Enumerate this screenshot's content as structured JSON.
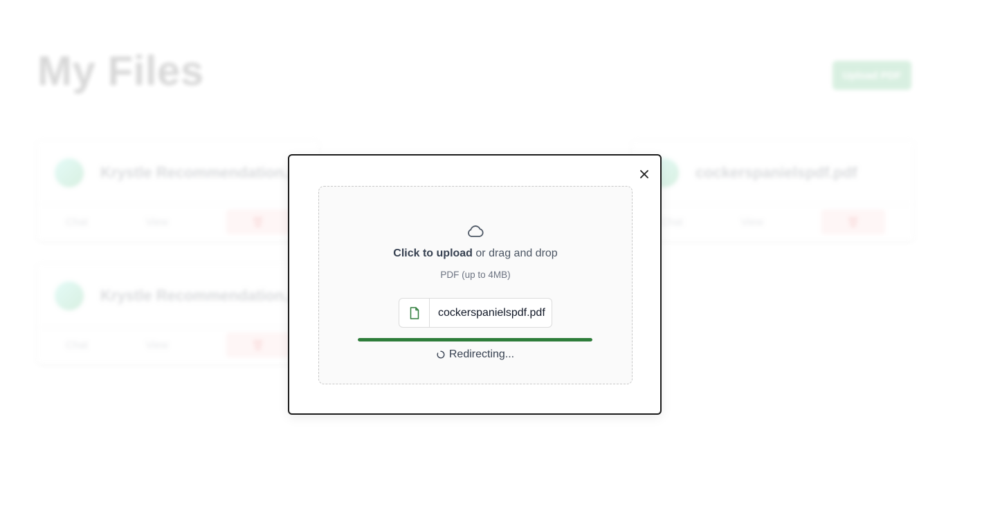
{
  "page": {
    "title": "My Files",
    "upload_button": "Upload PDF"
  },
  "files": [
    {
      "name": "Krystle Recommendation.pdf",
      "chat_label": "Chat",
      "view_label": "View"
    },
    {
      "name": "cockerspanielspdf.pdf",
      "chat_label": "Chat",
      "view_label": "View"
    },
    {
      "name": "Krystle Recommendation.pdf",
      "chat_label": "Chat",
      "view_label": "View"
    }
  ],
  "modal": {
    "click_text": "Click to upload",
    "drag_text": " or drag and drop",
    "hint": "PDF (up to 4MB)",
    "file_name": "cockerspanielspdf.pdf",
    "progress": 1.0,
    "status": "Redirecting...",
    "progress_color": "#2e7d3a",
    "icons": {
      "close": "close-icon",
      "cloud": "cloud-icon",
      "file": "file-icon",
      "spinner": "spinner-icon"
    }
  }
}
